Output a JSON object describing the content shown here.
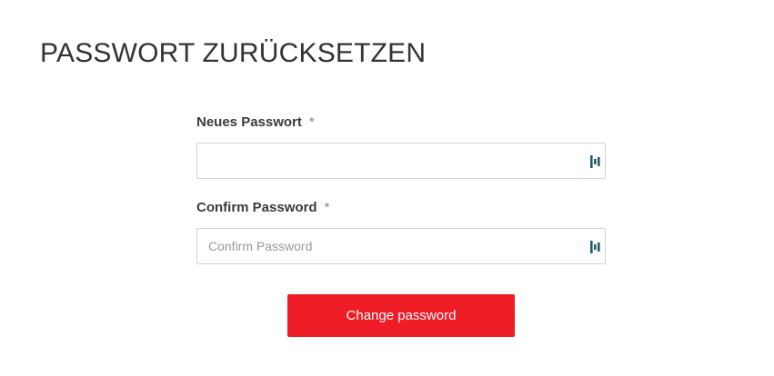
{
  "page": {
    "title": "PASSWORT ZURÜCKSETZEN"
  },
  "form": {
    "new_password": {
      "label": "Neues Passwort",
      "required_marker": "*",
      "value": "",
      "placeholder": "",
      "icon": "password-manager-icon"
    },
    "confirm_password": {
      "label": "Confirm Password",
      "required_marker": "*",
      "value": "",
      "placeholder": "Confirm Password",
      "icon": "password-manager-icon"
    },
    "submit_label": "Change password"
  },
  "colors": {
    "accent": "#ee1c25",
    "icon": "#1f5f6b"
  }
}
